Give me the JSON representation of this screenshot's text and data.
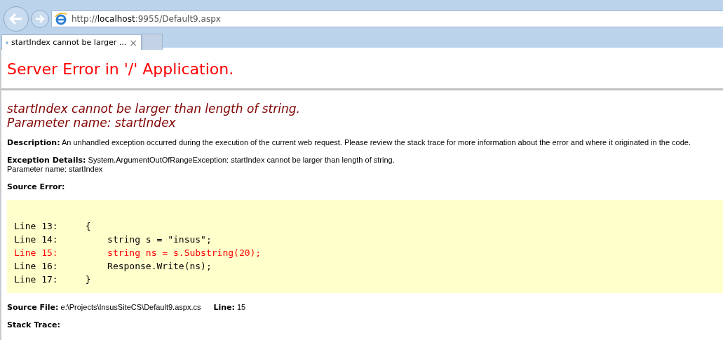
{
  "browser": {
    "address": {
      "prefix": "http://",
      "host": "localhost",
      "rest": ":9955/Default9.aspx"
    },
    "tabs": [
      {
        "label": "startIndex cannot be larger ...",
        "close": "×",
        "selected": true
      }
    ]
  },
  "page": {
    "title": "Server Error in '/' Application.",
    "error_heading": [
      "startIndex cannot be larger than length of string.",
      "Parameter name: startIndex"
    ],
    "description": {
      "label": "Description:",
      "text": "An unhandled exception occurred during the execution of the current web request. Please review the stack trace for more information about the error and where it originated in the code."
    },
    "exception_details": {
      "label": "Exception Details:",
      "lines": [
        "System.ArgumentOutOfRangeException: startIndex cannot be larger than length of string.",
        "Parameter name: startIndex"
      ]
    },
    "source_error": {
      "label": "Source Error:",
      "lines": [
        {
          "text": "Line 13:     {",
          "highlighted": false
        },
        {
          "text": "Line 14:         string s = \"insus\";",
          "highlighted": false
        },
        {
          "text": "Line 15:         string ns = s.Substring(20);",
          "highlighted": true
        },
        {
          "text": "Line 16:         Response.Write(ns);",
          "highlighted": false
        },
        {
          "text": "Line 17:     }",
          "highlighted": false
        }
      ]
    },
    "source_file": {
      "label": "Source File:",
      "path": "e:\\Projects\\InsusSiteCS\\Default9.aspx.cs",
      "line_label": "Line:",
      "line": "15"
    },
    "stack_trace": {
      "label": "Stack Trace:"
    }
  }
}
